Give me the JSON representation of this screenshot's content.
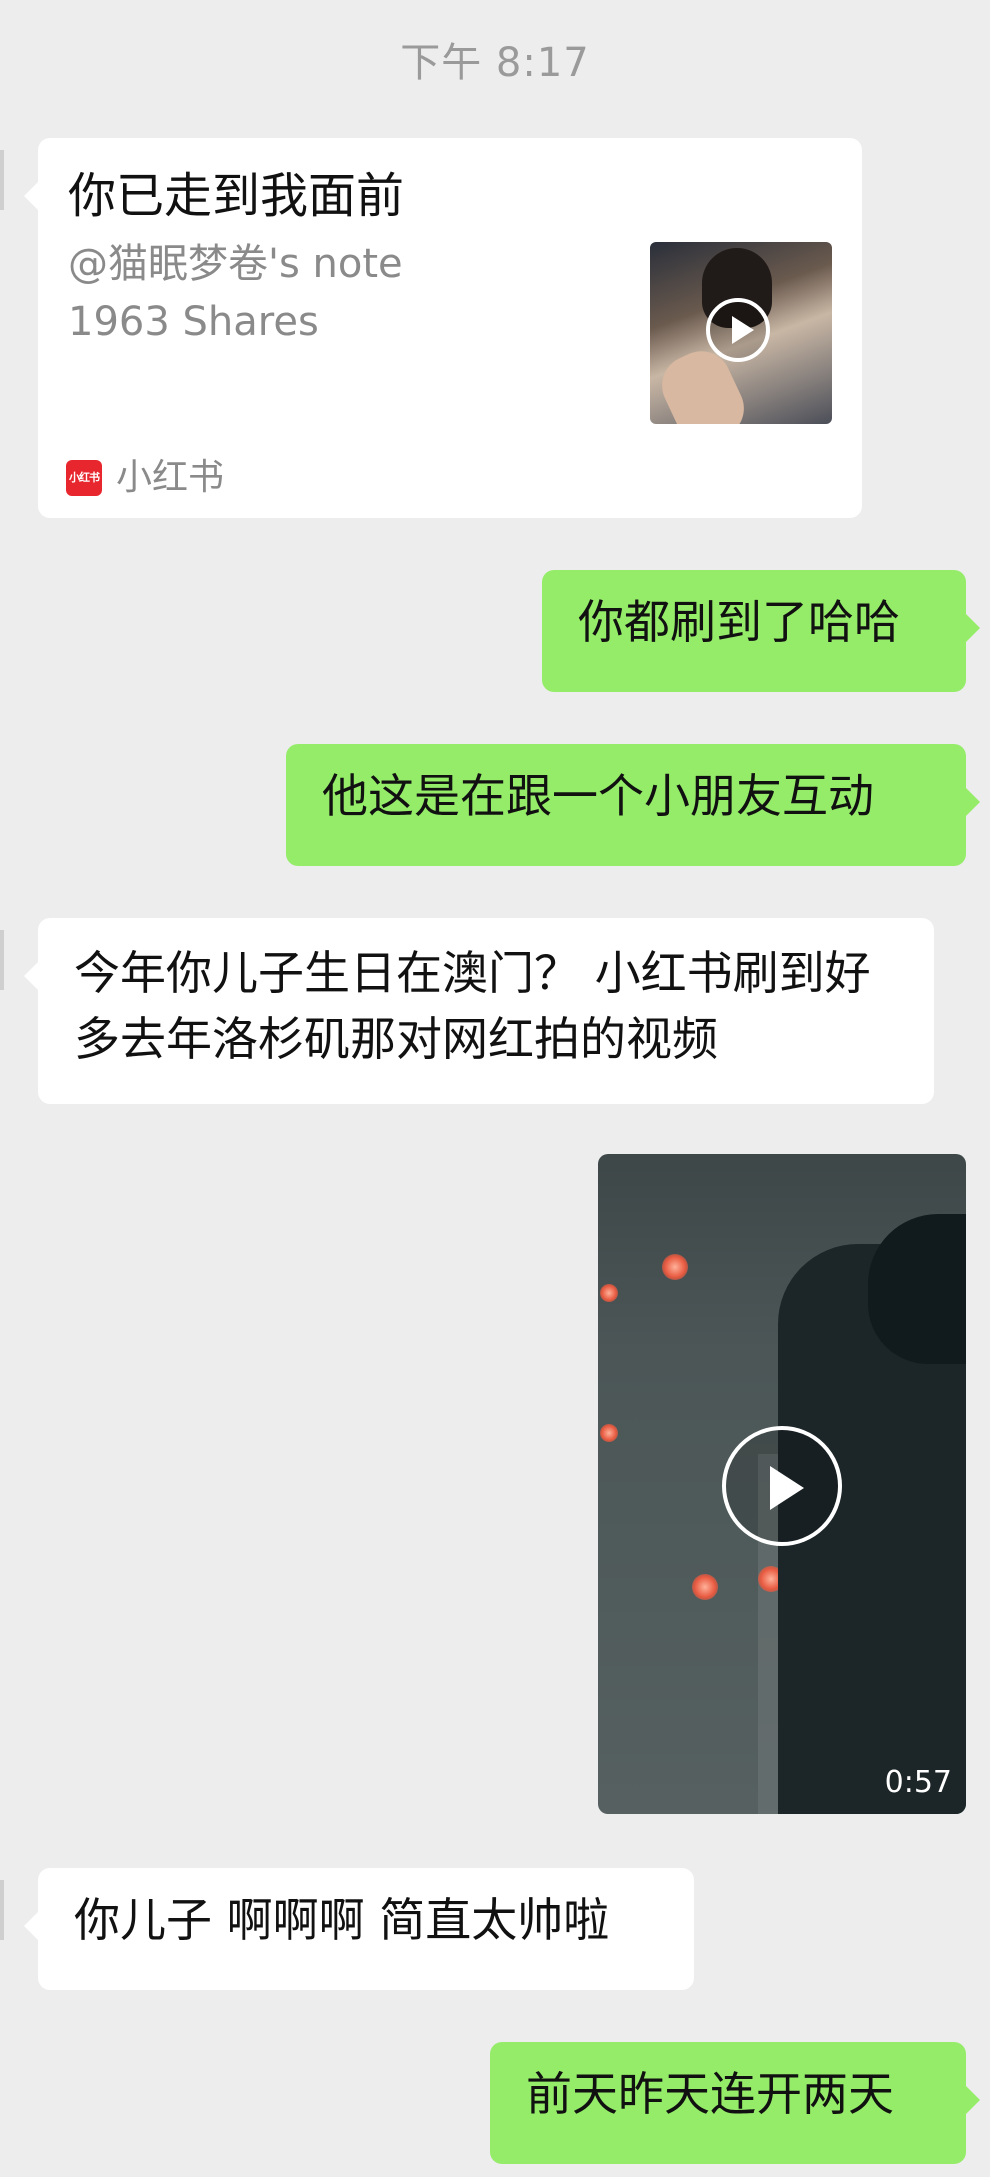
{
  "timestamp": "下午 8:17",
  "messages": [
    {
      "type": "share_card",
      "side": "left",
      "title": "你已走到我面前",
      "author": "@猫眠梦卷's note",
      "shares": "1963 Shares",
      "source_name": "小红书",
      "source_logo_text": "小红书",
      "source_color": "#e8262e"
    },
    {
      "type": "text",
      "side": "right",
      "text": "你都刷到了哈哈"
    },
    {
      "type": "text",
      "side": "right",
      "text": "他这是在跟一个小朋友互动"
    },
    {
      "type": "text",
      "side": "left",
      "text": "今年你儿子生日在澳门？ 小红书刷到好多去年洛杉矶那对网红拍的视频"
    },
    {
      "type": "video",
      "side": "right",
      "duration": "0:57"
    },
    {
      "type": "text",
      "side": "left",
      "text": "你儿子 啊啊啊 简直太帅啦"
    },
    {
      "type": "text",
      "side": "right",
      "text": "前天昨天连开两天"
    }
  ],
  "colors": {
    "background": "#ededed",
    "sent_bubble": "#95ec69",
    "received_bubble": "#ffffff"
  }
}
